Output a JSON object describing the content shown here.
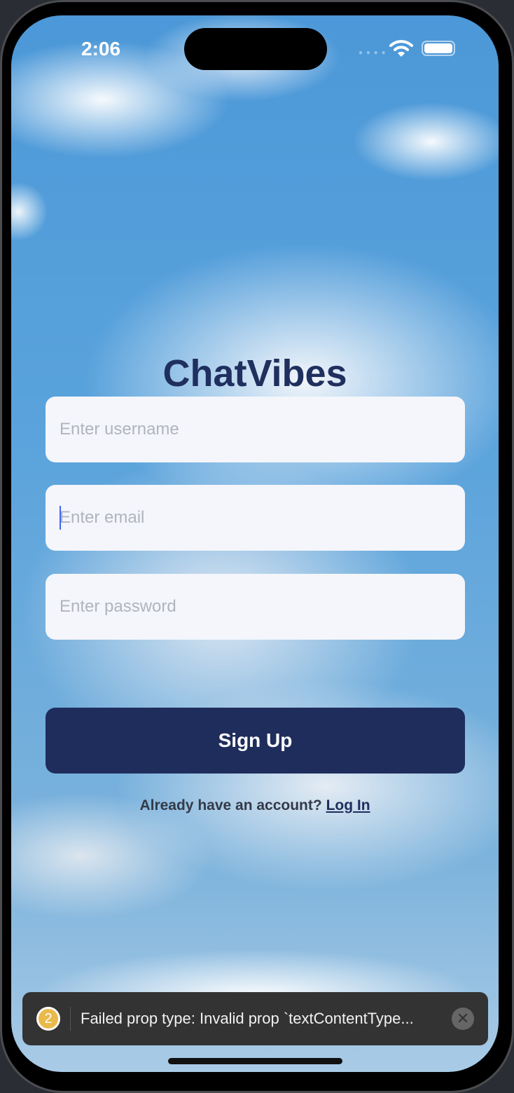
{
  "status_bar": {
    "time": "2:06"
  },
  "app": {
    "title": "ChatVibes"
  },
  "form": {
    "username_placeholder": "Enter username",
    "email_placeholder": "Enter email",
    "password_placeholder": "Enter password",
    "signup_label": "Sign Up",
    "login_prompt": "Already have an account?",
    "login_link": "Log In"
  },
  "toast": {
    "count": "2",
    "message": "Failed prop type: Invalid prop `textContentType..."
  },
  "colors": {
    "primary": "#1f2d5c",
    "warning": "#e9b94a",
    "caret": "#3f64f0"
  }
}
